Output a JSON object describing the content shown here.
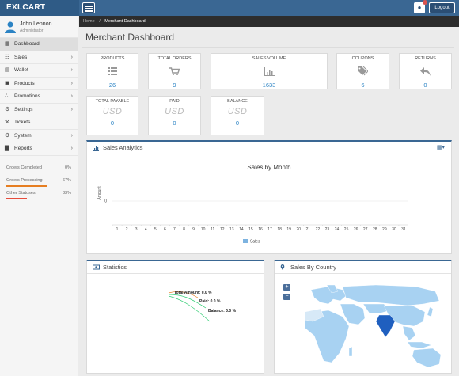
{
  "brand": "EXLCART",
  "topbar": {
    "logout_label": "Logout"
  },
  "user": {
    "name": "John Lennon",
    "role": "Administrator"
  },
  "sidebar": {
    "items": [
      {
        "label": "Dashboard",
        "icon": "dashboard-icon",
        "active": true,
        "has_children": false
      },
      {
        "label": "Sales",
        "icon": "cart-icon",
        "has_children": true
      },
      {
        "label": "Wallet",
        "icon": "wallet-icon",
        "has_children": true
      },
      {
        "label": "Products",
        "icon": "box-icon",
        "has_children": true
      },
      {
        "label": "Promotions",
        "icon": "share-icon",
        "has_children": true
      },
      {
        "label": "Settings",
        "icon": "gear-icon",
        "has_children": true
      },
      {
        "label": "Tickets",
        "icon": "wrench-icon",
        "has_children": false
      },
      {
        "label": "System",
        "icon": "cog-icon",
        "has_children": true
      },
      {
        "label": "Reports",
        "icon": "bar-chart-icon",
        "has_children": true
      }
    ],
    "progress": [
      {
        "label": "Orders Completed",
        "pct": "0%",
        "value": 0,
        "color": "#e67e22"
      },
      {
        "label": "Orders Processing",
        "pct": "67%",
        "value": 67,
        "color": "#e67e22"
      },
      {
        "label": "Other Statuses",
        "pct": "33%",
        "value": 33,
        "color": "#e74c3c"
      }
    ]
  },
  "breadcrumb": {
    "home": "Home",
    "separator": "/",
    "current": "Merchant Dashboard"
  },
  "page_title": "Merchant Dashboard",
  "stats": [
    {
      "label": "PRODUCTS",
      "icon": "list-icon",
      "value": "26"
    },
    {
      "label": "TOTAL ORDERS",
      "icon": "cart-icon",
      "value": "9"
    },
    {
      "label": "SALES VOLUME",
      "icon": "bar-chart-icon",
      "value": "1633"
    },
    {
      "label": "COUPONS",
      "icon": "tags-icon",
      "value": "6"
    },
    {
      "label": "RETURNS",
      "icon": "reply-icon",
      "value": "0"
    }
  ],
  "balances": [
    {
      "label": "TOTAL PAYABLE",
      "currency": "USD",
      "value": "0"
    },
    {
      "label": "PAID",
      "currency": "USD",
      "value": "0"
    },
    {
      "label": "BALANCE",
      "currency": "USD",
      "value": "0"
    }
  ],
  "sales_analytics": {
    "title": "Sales Analytics",
    "chart_title": "Sales by Month",
    "ylabel": "Amount",
    "legend": "Sales"
  },
  "chart_data": {
    "type": "bar",
    "title": "Sales by Month",
    "xlabel": "",
    "ylabel": "Amount",
    "categories": [
      "1",
      "2",
      "3",
      "4",
      "5",
      "6",
      "7",
      "8",
      "9",
      "10",
      "11",
      "12",
      "13",
      "14",
      "15",
      "16",
      "17",
      "18",
      "19",
      "20",
      "21",
      "22",
      "23",
      "24",
      "25",
      "26",
      "27",
      "28",
      "29",
      "30",
      "31"
    ],
    "series": [
      {
        "name": "Sales",
        "values": [
          0,
          0,
          0,
          0,
          0,
          0,
          0,
          0,
          0,
          0,
          0,
          0,
          0,
          0,
          0,
          0,
          0,
          0,
          0,
          0,
          0,
          0,
          0,
          0,
          0,
          0,
          0,
          0,
          0,
          0,
          0
        ]
      }
    ],
    "yticks": [
      "0"
    ],
    "legend": "bottom",
    "color": "#7db3e0"
  },
  "statistics": {
    "title": "Statistics",
    "labels": [
      "Total Amount: 0.0 %",
      "Paid: 0.0 %",
      "Balance: 0.0 %"
    ]
  },
  "sales_by_country": {
    "title": "Sales By Country",
    "zoom_in": "+",
    "zoom_out": "−"
  }
}
